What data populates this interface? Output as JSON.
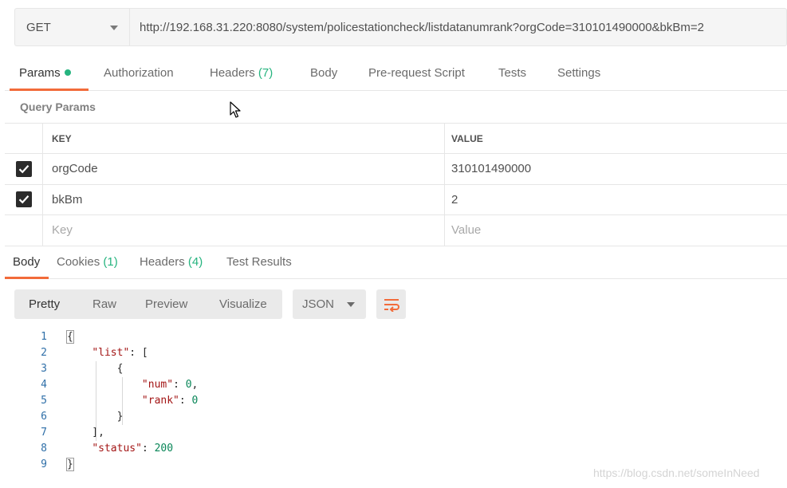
{
  "request": {
    "method": "GET",
    "url": "http://192.168.31.220:8080/system/policestationcheck/listdatanumrank?orgCode=310101490000&bkBm=2"
  },
  "request_tabs": [
    {
      "label": "Params",
      "count": "",
      "dot": true,
      "active": true
    },
    {
      "label": "Authorization",
      "count": "",
      "dot": false,
      "active": false
    },
    {
      "label": "Headers",
      "count": "(7)",
      "dot": false,
      "active": false
    },
    {
      "label": "Body",
      "count": "",
      "dot": false,
      "active": false
    },
    {
      "label": "Pre-request Script",
      "count": "",
      "dot": false,
      "active": false
    },
    {
      "label": "Tests",
      "count": "",
      "dot": false,
      "active": false
    },
    {
      "label": "Settings",
      "count": "",
      "dot": false,
      "active": false
    }
  ],
  "query_params": {
    "title": "Query Params",
    "key_header": "KEY",
    "value_header": "VALUE",
    "rows": [
      {
        "key": "orgCode",
        "value": "310101490000",
        "checked": true
      },
      {
        "key": "bkBm",
        "value": "2",
        "checked": true
      }
    ],
    "key_placeholder": "Key",
    "value_placeholder": "Value"
  },
  "response_tabs": [
    {
      "label": "Body",
      "count": "",
      "active": true
    },
    {
      "label": "Cookies",
      "count": "(1)",
      "active": false
    },
    {
      "label": "Headers",
      "count": "(4)",
      "active": false
    },
    {
      "label": "Test Results",
      "count": "",
      "active": false
    }
  ],
  "format_buttons": [
    "Pretty",
    "Raw",
    "Preview",
    "Visualize"
  ],
  "language": "JSON",
  "code_lines": [
    {
      "num": "1",
      "parts": [
        {
          "t": "p",
          "v": "{"
        }
      ]
    },
    {
      "num": "2",
      "parts": [
        {
          "t": "p",
          "v": "    "
        },
        {
          "t": "k",
          "v": "\"list\""
        },
        {
          "t": "p",
          "v": ": ["
        }
      ]
    },
    {
      "num": "3",
      "parts": [
        {
          "t": "p",
          "v": "        {"
        }
      ]
    },
    {
      "num": "4",
      "parts": [
        {
          "t": "p",
          "v": "            "
        },
        {
          "t": "k",
          "v": "\"num\""
        },
        {
          "t": "p",
          "v": ": "
        },
        {
          "t": "n",
          "v": "0"
        },
        {
          "t": "p",
          "v": ","
        }
      ]
    },
    {
      "num": "5",
      "parts": [
        {
          "t": "p",
          "v": "            "
        },
        {
          "t": "k",
          "v": "\"rank\""
        },
        {
          "t": "p",
          "v": ": "
        },
        {
          "t": "n",
          "v": "0"
        }
      ]
    },
    {
      "num": "6",
      "parts": [
        {
          "t": "p",
          "v": "        }"
        }
      ]
    },
    {
      "num": "7",
      "parts": [
        {
          "t": "p",
          "v": "    ],"
        }
      ]
    },
    {
      "num": "8",
      "parts": [
        {
          "t": "p",
          "v": "    "
        },
        {
          "t": "k",
          "v": "\"status\""
        },
        {
          "t": "p",
          "v": ": "
        },
        {
          "t": "n",
          "v": "200"
        }
      ]
    },
    {
      "num": "9",
      "parts": [
        {
          "t": "p",
          "v": "}"
        }
      ]
    }
  ],
  "watermark": "https://blog.csdn.net/someInNeed",
  "colors": {
    "accent": "#f26b3a",
    "count": "#26b47f"
  }
}
